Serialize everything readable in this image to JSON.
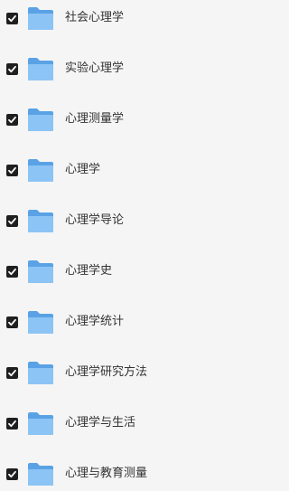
{
  "colors": {
    "background": "#f5f5f5",
    "checkbox": "#1f1f1f",
    "folder_back": "#5aa2e5",
    "folder_front": "#8cc4f5",
    "text": "#333333"
  },
  "folder_list": {
    "items": [
      {
        "name": "社会心理学",
        "checked": true,
        "icon": "folder-icon"
      },
      {
        "name": "实验心理学",
        "checked": true,
        "icon": "folder-icon"
      },
      {
        "name": "心理测量学",
        "checked": true,
        "icon": "folder-icon"
      },
      {
        "name": "心理学",
        "checked": true,
        "icon": "folder-icon"
      },
      {
        "name": "心理学导论",
        "checked": true,
        "icon": "folder-icon"
      },
      {
        "name": "心理学史",
        "checked": true,
        "icon": "folder-icon"
      },
      {
        "name": "心理学统计",
        "checked": true,
        "icon": "folder-icon"
      },
      {
        "name": "心理学研究方法",
        "checked": true,
        "icon": "folder-icon"
      },
      {
        "name": "心理学与生活",
        "checked": true,
        "icon": "folder-icon"
      },
      {
        "name": "心理与教育测量",
        "checked": true,
        "icon": "folder-icon"
      }
    ]
  }
}
